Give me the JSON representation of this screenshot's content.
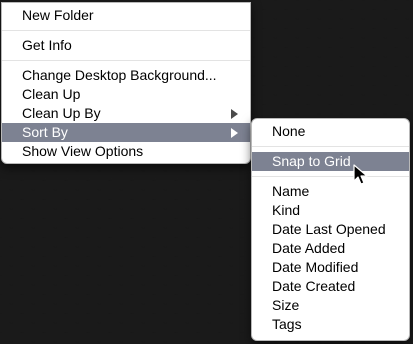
{
  "context_menu": {
    "items": [
      {
        "label": "New Folder"
      },
      {
        "label": "Get Info"
      },
      {
        "label": "Change Desktop Background..."
      },
      {
        "label": "Clean Up"
      },
      {
        "label": "Clean Up By"
      },
      {
        "label": "Sort By"
      },
      {
        "label": "Show View Options"
      }
    ]
  },
  "submenu": {
    "items": [
      {
        "label": "None"
      },
      {
        "label": "Snap to Grid"
      },
      {
        "label": "Name"
      },
      {
        "label": "Kind"
      },
      {
        "label": "Date Last Opened"
      },
      {
        "label": "Date Added"
      },
      {
        "label": "Date Modified"
      },
      {
        "label": "Date Created"
      },
      {
        "label": "Size"
      },
      {
        "label": "Tags"
      }
    ]
  },
  "colors": {
    "highlight": "#7d8292",
    "menu_background": "#ffffff",
    "desktop_background": "#141414"
  },
  "icons": {
    "submenu_arrow": "chevron-right-icon",
    "pointer": "mouse-pointer-icon"
  }
}
